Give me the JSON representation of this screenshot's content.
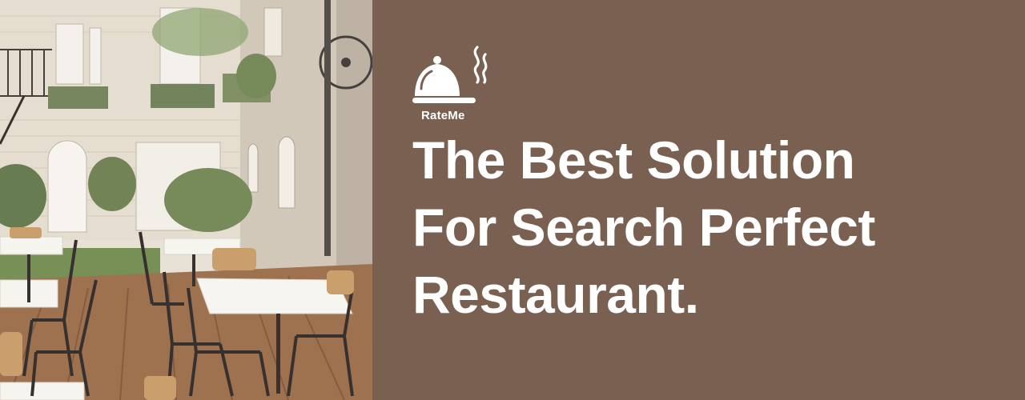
{
  "brand": {
    "name": "RateMe",
    "logo_icon": "cloche-icon",
    "background_color": "#7a6051",
    "text_color": "#ffffff"
  },
  "hero": {
    "headline_lines": [
      "The Best Solution",
      "For Search Perfect",
      "Restaurant."
    ],
    "image": "restaurant-courtyard-photo"
  }
}
